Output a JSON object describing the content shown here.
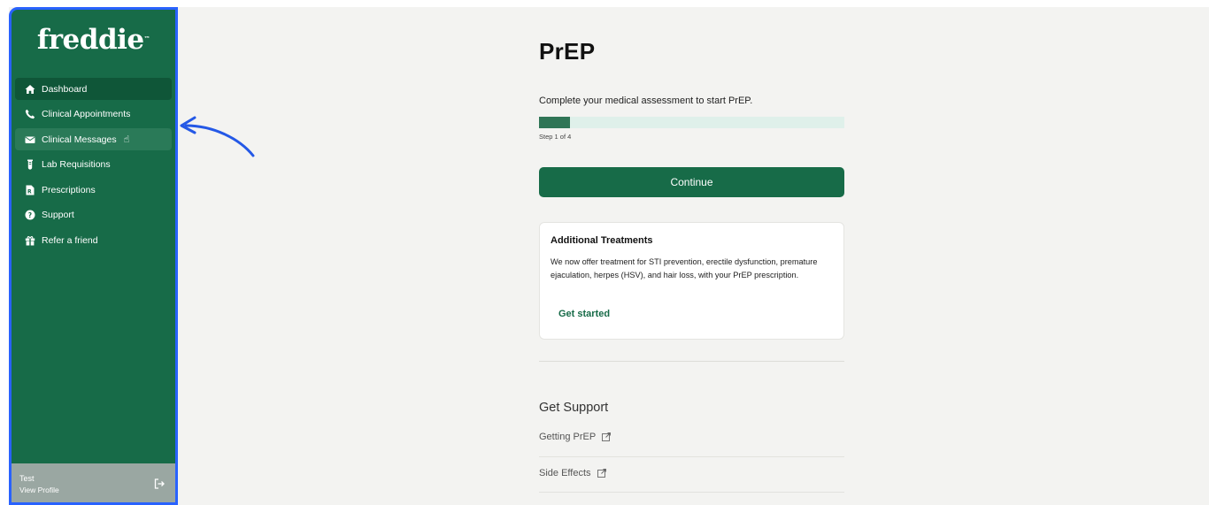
{
  "sidebar": {
    "logo": "freddie",
    "logo_mark": "™",
    "items": [
      {
        "label": "Dashboard",
        "icon": "home-icon"
      },
      {
        "label": "Clinical Appointments",
        "icon": "phone-icon"
      },
      {
        "label": "Clinical Messages",
        "icon": "envelope-icon"
      },
      {
        "label": "Lab Requisitions",
        "icon": "test-tube-icon"
      },
      {
        "label": "Prescriptions",
        "icon": "prescription-icon"
      },
      {
        "label": "Support",
        "icon": "question-icon"
      },
      {
        "label": "Refer a friend",
        "icon": "gift-icon"
      }
    ],
    "profile": {
      "name": "Test",
      "view_label": "View Profile"
    }
  },
  "main": {
    "title": "PrEP",
    "subtitle": "Complete your medical assessment to start PrEP.",
    "progress": {
      "current_step": 1,
      "total_steps": 4,
      "fraction": 0.1,
      "label": "Step 1 of 4"
    },
    "continue_label": "Continue",
    "card": {
      "title": "Additional Treatments",
      "body": "We now offer treatment for STI prevention, erectile dysfunction, premature ejaculation, herpes (HSV), and hair loss, with your PrEP prescription.",
      "link": "Get started"
    },
    "support": {
      "title": "Get Support",
      "links": [
        "Getting PrEP",
        "Side Effects"
      ]
    }
  },
  "colors": {
    "brand_green": "#176b48",
    "highlight_border": "#2962ff",
    "progress_track": "#dff0ea",
    "background": "#f3f3f1"
  }
}
